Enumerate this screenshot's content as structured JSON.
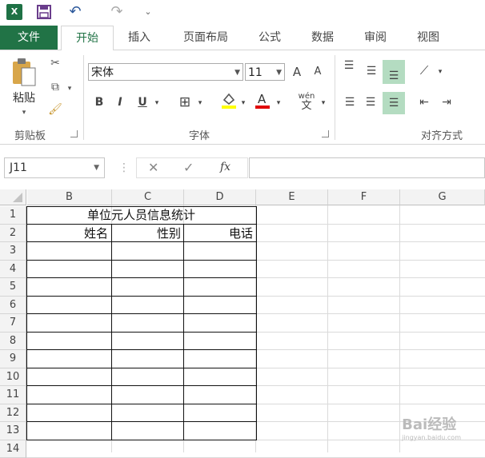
{
  "qat": {
    "logo": "X",
    "undo": "↶",
    "redo": "↷",
    "more": "⌄"
  },
  "tabs": [
    {
      "label": "文件"
    },
    {
      "label": "开始"
    },
    {
      "label": "插入"
    },
    {
      "label": "页面布局"
    },
    {
      "label": "公式"
    },
    {
      "label": "数据"
    },
    {
      "label": "审阅"
    },
    {
      "label": "视图"
    }
  ],
  "ribbon": {
    "paste_label": "粘贴",
    "clipboard_label": "剪贴板",
    "font_name": "宋体",
    "font_size": "11",
    "grow_font": "A",
    "shrink_font": "A",
    "bold": "B",
    "italic": "I",
    "underline": "U",
    "phonetic": "wén",
    "font_group_label": "字体",
    "align_group_label": "对齐方式"
  },
  "formula_bar": {
    "name_box": "J11",
    "fx": "fx",
    "cancel": "✕",
    "enter": "✓"
  },
  "columns": [
    "B",
    "C",
    "D",
    "E",
    "F",
    "G"
  ],
  "rows": [
    "1",
    "2",
    "3",
    "4",
    "5",
    "6",
    "7",
    "8",
    "9",
    "10",
    "11",
    "12",
    "13",
    "14"
  ],
  "sheet": {
    "title": "单位元人员信息统计",
    "headers": [
      "姓名",
      "性别",
      "电话"
    ]
  },
  "watermark": {
    "text": "Bai经验",
    "url": "jingyan.baidu.com"
  },
  "colors": {
    "excel_green": "#217346",
    "align_highlight": "#b4dcc1"
  }
}
